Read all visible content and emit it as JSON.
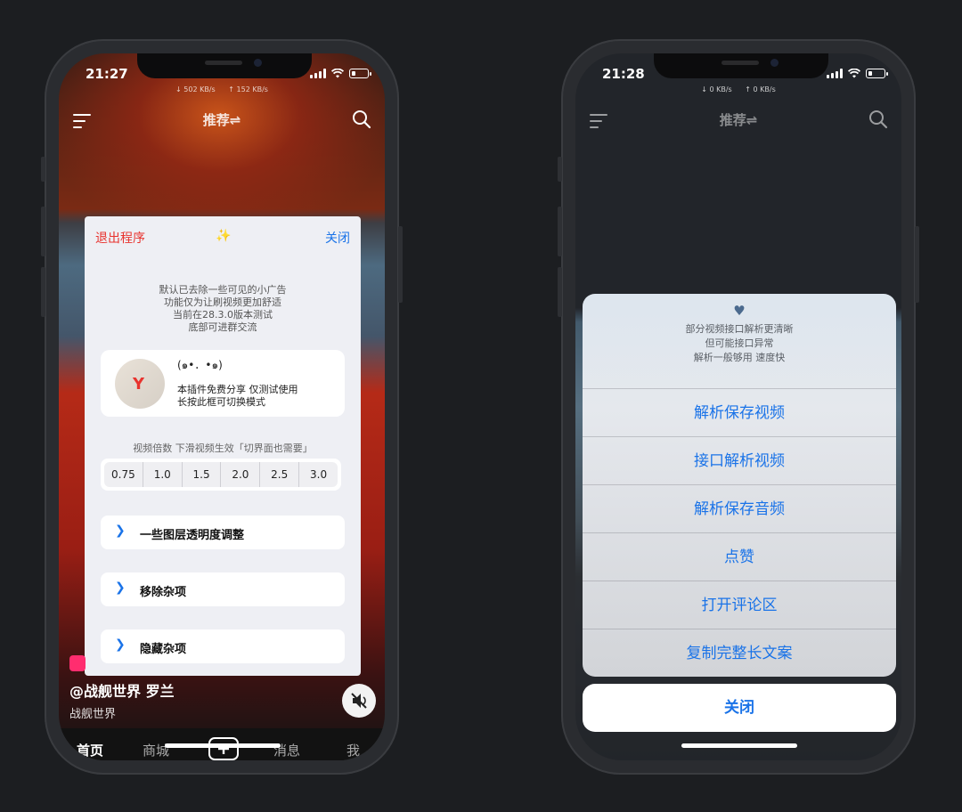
{
  "left": {
    "status": {
      "time": "21:27",
      "down": "502 KB/s",
      "up": "152 KB/s"
    },
    "topbar": {
      "title": "推荐⇌"
    },
    "dialog": {
      "exit_label": "退出程序",
      "sparkle": "✨",
      "close_label": "关闭",
      "notes": [
        "默认已去除一些可见的小广告",
        "功能仅为让刷视频更加舒适",
        "当前在28.3.0版本测试",
        "底部可进群交流"
      ],
      "profile": {
        "avatar_letter": "Y",
        "emoticon": "(๑•．•๑)",
        "lines": [
          "本插件免费分享 仅测试使用",
          "长按此框可切换模式"
        ]
      },
      "speed_label": "视频倍数 下滑视频生效「切界面也需要」",
      "speeds": [
        "0.75",
        "1.0",
        "1.5",
        "2.0",
        "2.5",
        "3.0"
      ],
      "rows": [
        "一些图层透明度调整",
        "移除杂项",
        "隐藏杂项"
      ]
    },
    "video": {
      "author": "@战舰世界 罗兰",
      "subtitle": "战舰世界"
    },
    "tabs": [
      "首页",
      "商城",
      "消息",
      "我"
    ]
  },
  "right": {
    "status": {
      "time": "21:28",
      "down": "0 KB/s",
      "up": "0 KB/s"
    },
    "topbar": {
      "title": "推荐⇌"
    },
    "sheet": {
      "heart": "♥",
      "message": [
        "部分视频接口解析更清晰",
        "但可能接口异常",
        "解析一般够用 速度快"
      ],
      "actions": [
        "解析保存视频",
        "接口解析视频",
        "解析保存音频",
        "点赞",
        "打开评论区",
        "复制完整长文案"
      ],
      "close_label": "关闭"
    }
  },
  "colors": {
    "accent_blue": "#1a73e8",
    "exit_red": "#e8332e"
  }
}
